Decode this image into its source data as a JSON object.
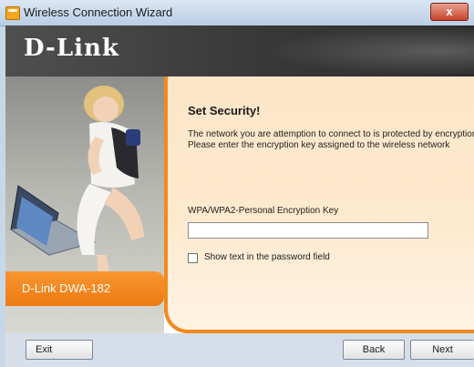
{
  "window": {
    "title": "Wireless Connection Wizard",
    "close_label": "x"
  },
  "header": {
    "logo": "D-Link"
  },
  "sidebar": {
    "model": "D-Link DWA-182"
  },
  "panel": {
    "title": "Set Security!",
    "description": "The network you are attemption to connect to is protected by encryption. Please enter the encryption key assigned to the wireless network",
    "key_label": "WPA/WPA2-Personal Encryption Key",
    "key_value": "",
    "show_text_label": "Show text in the password field",
    "show_text_checked": false
  },
  "footer": {
    "exit_label": "Exit",
    "back_label": "Back",
    "next_label": "Next"
  },
  "colors": {
    "accent": "#f08a1d",
    "panel_bg": "#fde9ce",
    "header_bg": "#3a3a3a"
  },
  "icons": {
    "app": "wizard-app-icon",
    "close": "close-icon"
  }
}
